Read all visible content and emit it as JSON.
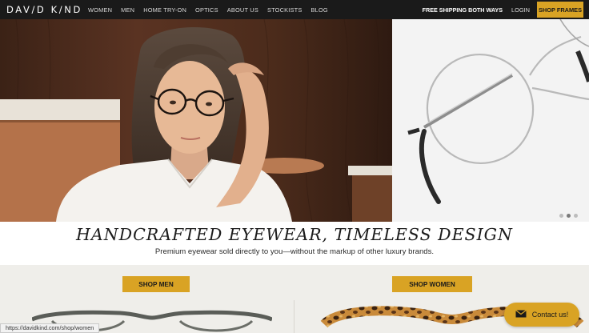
{
  "nav": {
    "logo": "DAV/D K/ND",
    "links": [
      "WOMEN",
      "MEN",
      "HOME TRY-ON",
      "OPTICS",
      "ABOUT US",
      "STOCKISTS",
      "BLOG"
    ],
    "shipping": "FREE SHIPPING BOTH WAYS",
    "login": "LOGIN",
    "cta": "SHOP FRAMES"
  },
  "hero": {
    "slides_total": 3,
    "active_slide": 2
  },
  "tagline": {
    "headline": "HANDCRAFTED EYEWEAR, TIMELESS DESIGN",
    "subline": "Premium eyewear sold directly to you—without the markup of other luxury brands."
  },
  "sections": {
    "men_button": "SHOP MEN",
    "women_button": "SHOP WOMEN"
  },
  "status_bar": {
    "url": "https://davidkind.com/shop/women"
  },
  "chat": {
    "label": "Contact us!"
  },
  "colors": {
    "nav_bg": "#1a1a1a",
    "accent": "#d9a324",
    "section_bg": "#efeeea"
  }
}
